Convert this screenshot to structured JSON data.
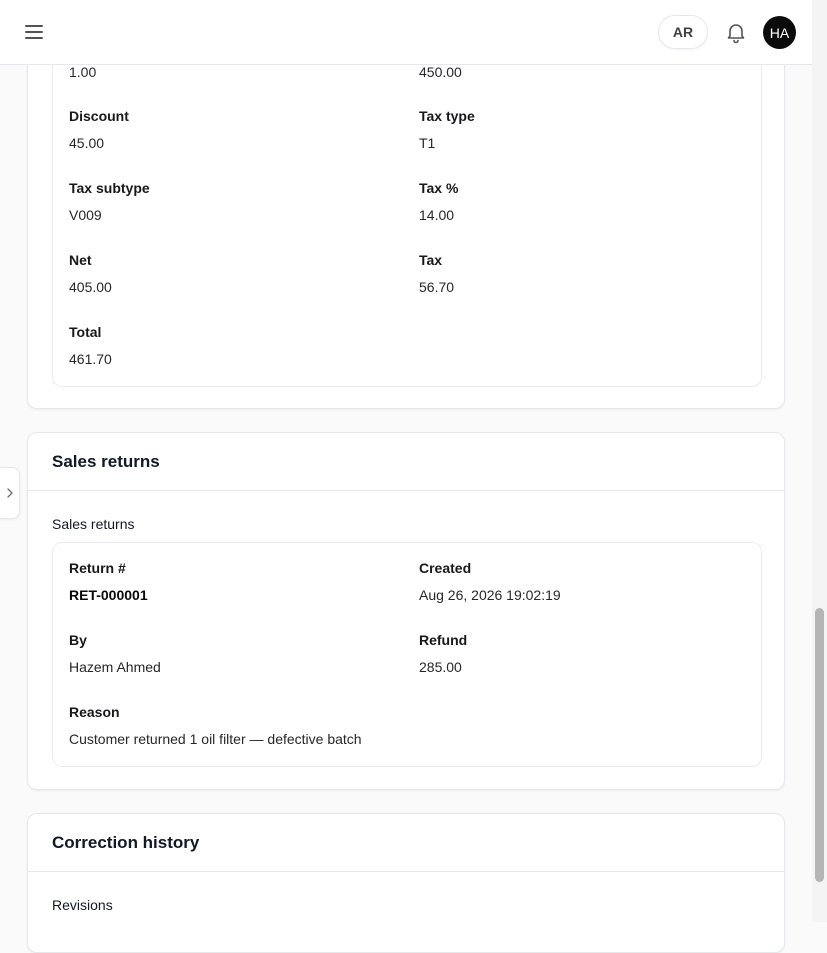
{
  "header": {
    "language_label": "AR",
    "avatar_initials": "HA"
  },
  "line_item": {
    "quantity_value": "1.00",
    "unit_price_value": "450.00",
    "discount": {
      "label": "Discount",
      "value": "45.00"
    },
    "tax_type": {
      "label": "Tax type",
      "value": "T1"
    },
    "tax_subtype": {
      "label": "Tax subtype",
      "value": "V009"
    },
    "tax_percent": {
      "label": "Tax %",
      "value": "14.00"
    },
    "net": {
      "label": "Net",
      "value": "405.00"
    },
    "tax": {
      "label": "Tax",
      "value": "56.70"
    },
    "total": {
      "label": "Total",
      "value": "461.70"
    }
  },
  "sales_returns": {
    "title": "Sales returns",
    "subtitle": "Sales returns",
    "items": [
      {
        "return_no": {
          "label": "Return #",
          "value": "RET-000001"
        },
        "created": {
          "label": "Created",
          "value": "Aug 26, 2026 19:02:19"
        },
        "by": {
          "label": "By",
          "value": "Hazem Ahmed"
        },
        "refund": {
          "label": "Refund",
          "value": "285.00"
        },
        "reason": {
          "label": "Reason",
          "value": "Customer returned 1 oil filter — defective batch"
        }
      }
    ]
  },
  "correction_history": {
    "title": "Correction history",
    "subtitle": "Revisions"
  },
  "icons": {
    "menu": "menu-icon",
    "bell": "bell-icon",
    "side_toggle": "chevron-right-icon"
  }
}
